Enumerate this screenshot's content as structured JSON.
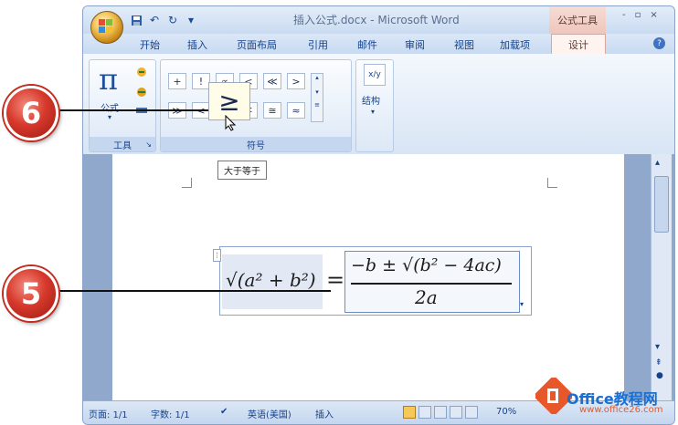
{
  "window": {
    "title": "插入公式.docx - Microsoft Word",
    "tool_tab_title": "公式工具",
    "controls": [
      "-",
      "▫",
      "×"
    ]
  },
  "quick_access": {
    "icons": [
      "save-icon",
      "undo-icon",
      "redo-icon",
      "customize-qat-icon"
    ]
  },
  "tabs": [
    "开始",
    "插入",
    "页面布局",
    "引用",
    "邮件",
    "审阅",
    "视图",
    "加载项",
    "设计"
  ],
  "active_tab": "设计",
  "ribbon": {
    "tools_group": {
      "label": "工具",
      "equation_symbol": "π",
      "equation_label": "公式"
    },
    "symbols_group": {
      "label": "符号",
      "row1": [
        "+",
        "!",
        "∝",
        "<",
        "≪",
        ">"
      ],
      "row2": [
        "≫",
        "<",
        "≥",
        "∓",
        "≅",
        "≈"
      ]
    },
    "structures_group": {
      "fraction_symbol": "x/y",
      "label": "结构"
    }
  },
  "hover_symbol": "≥",
  "tooltip": "大于等于",
  "callouts": [
    "6",
    "5"
  ],
  "equation": {
    "left": "√(a² + b²)",
    "equals": "=",
    "numerator": "−b ± √(b² − 4ac)",
    "denominator": "2a"
  },
  "status_bar": {
    "page": "页面: 1/1",
    "words": "字数: 1/1",
    "language": "英语(美国)",
    "mode": "插入",
    "zoom": "70%"
  },
  "watermark": {
    "brand": "Office教程网",
    "url": "www.office26.com"
  }
}
